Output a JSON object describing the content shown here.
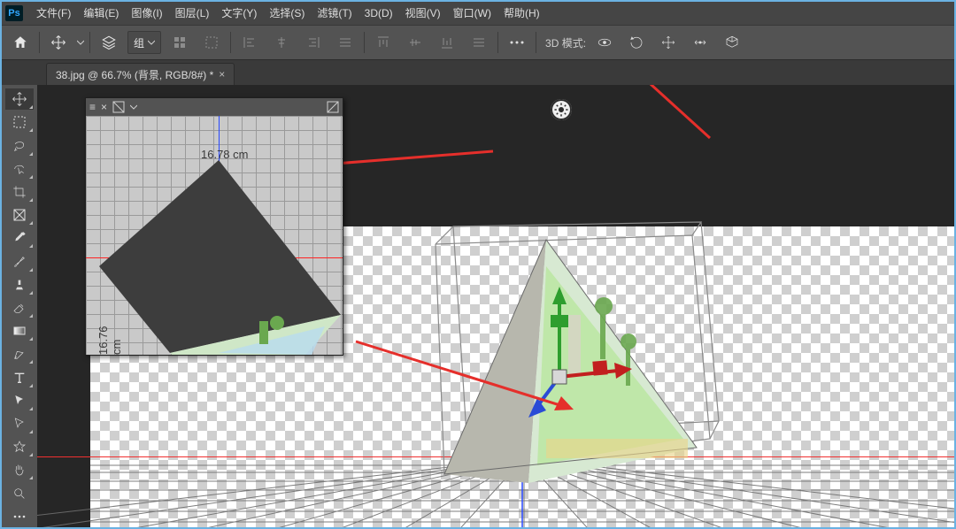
{
  "menu": {
    "items": [
      "文件(F)",
      "编辑(E)",
      "图像(I)",
      "图层(L)",
      "文字(Y)",
      "选择(S)",
      "滤镜(T)",
      "3D(D)",
      "视图(V)",
      "窗口(W)",
      "帮助(H)"
    ]
  },
  "optionsbar": {
    "group_label": "组",
    "mode3d_label": "3D 模式:"
  },
  "tab": {
    "title": "38.jpg @ 66.7% (背景, RGB/8#) *"
  },
  "mini_panel": {
    "measurement_top": "16.78 cm",
    "measurement_left": "16.76 cm"
  },
  "colors": {
    "accent_blue": "#31a8ff",
    "guide_blue": "#2848ff",
    "guide_red": "#ff2424",
    "annotation_red": "#e52f2b"
  },
  "tools": [
    "move-tool",
    "rect-marquee-tool",
    "lasso-tool",
    "quick-select-tool",
    "crop-tool",
    "eyedropper-tool",
    "spot-heal-tool",
    "brush-tool",
    "clone-stamp-tool",
    "history-brush-tool",
    "eraser-tool",
    "gradient-tool",
    "blur-tool",
    "dodge-tool",
    "pen-tool",
    "type-tool",
    "path-select-tool",
    "rectangle-tool",
    "hand-tool",
    "rotate-view-tool",
    "zoom-tool",
    "edit-toolbar",
    "more-tool"
  ]
}
